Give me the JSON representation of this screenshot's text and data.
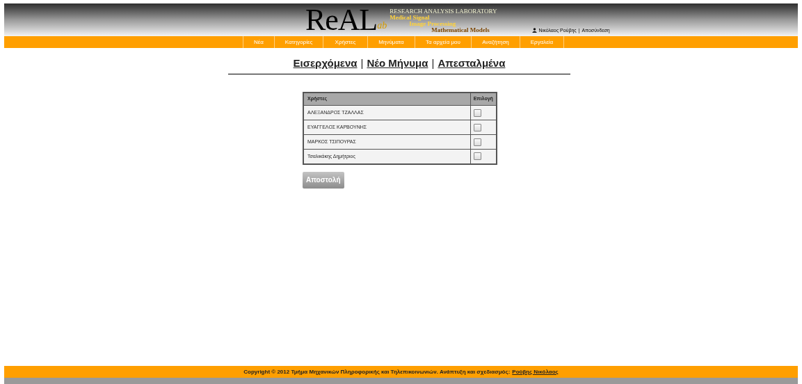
{
  "logo": {
    "big": "ReAL",
    "small": "ab",
    "tagline": "RESEARCH ANALYSIS LABORATORY",
    "lines": [
      "Medical Signal",
      "Image Processing",
      "Mathematical Models"
    ]
  },
  "user": {
    "name": "Νικόλαος Ρούβης",
    "separator": "|",
    "logout": "Αποσύνδεση"
  },
  "nav": [
    "Νέα",
    "Κατηγορίες",
    "Χρήστες",
    "Μηνύματα",
    "Τα αρχεία μου",
    "Αναζήτηση",
    "Εργαλεία"
  ],
  "message_tabs": [
    "Εισερχόμενα",
    "Νέο Μήνυμα",
    "Απεσταλμένα"
  ],
  "message_tab_separators": [
    "|",
    "|"
  ],
  "table": {
    "columns": [
      "Χρήστες",
      "Επιλογή"
    ],
    "rows": [
      {
        "name": "ΑΛΕΞΑΝΔΡΟΣ ΤΖΑΛΛΑΣ",
        "checked": false
      },
      {
        "name": "ΕΥΑΓΓΕΛΟΣ ΚΑΡΒΟΥΝΗΣ",
        "checked": false
      },
      {
        "name": "ΜΑΡΚΟΣ ΤΣΙΠΟΥΡΑΣ",
        "checked": false
      },
      {
        "name": "Τσαλικάκης Δημήτριος",
        "checked": false
      }
    ]
  },
  "send_button": "Αποστολή",
  "footer": {
    "text": "Copyright © 2012 Τμήμα Μηχανικών Πληροφορικής και Τηλεπικοινωνιών. Ανάπτυξη και σχεδιασμός:",
    "link": "Ρούβης Νικόλαος"
  }
}
